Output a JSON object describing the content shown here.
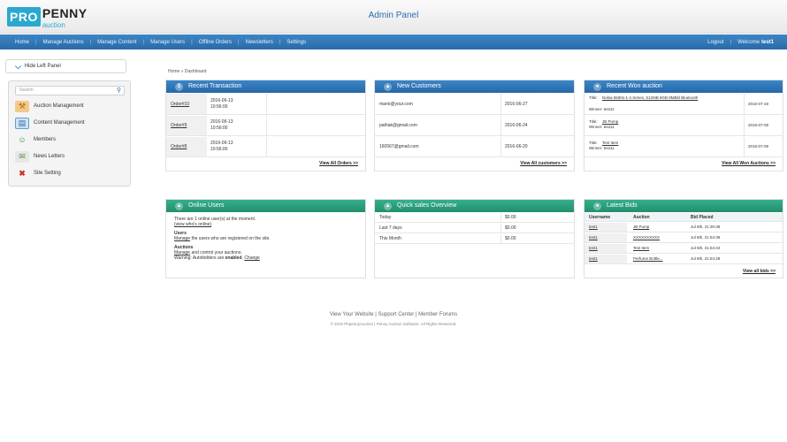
{
  "logo": {
    "pro": "PRO",
    "penny": "PENNY",
    "auction": "auction"
  },
  "header": {
    "title": "Admin Panel"
  },
  "nav": {
    "items": [
      "Home",
      "Manage Auctions",
      "Manage Content",
      "Manage Users",
      "Offline Orders",
      "Newsletters",
      "Settings"
    ],
    "logout": "Logout",
    "welcome": "Welcome",
    "username": "test1"
  },
  "sidebar": {
    "hide_label": "Hide Left Panel",
    "search_placeholder": "Search",
    "items": [
      "Auction Management",
      "Content Management",
      "Members",
      "News Letters",
      "Site Setting"
    ]
  },
  "breadcrumb": "Home » Dashboard",
  "recent_transaction": {
    "title": "Recent Transaction",
    "rows": [
      {
        "order": "Order#10",
        "date": "2016-06-13",
        "time": "10:56:00"
      },
      {
        "order": "Order#9",
        "date": "2016-06-13",
        "time": "10:56:00"
      },
      {
        "order": "Order#8",
        "date": "2016-06-13",
        "time": "10:56:00"
      }
    ],
    "view_all": "View All Orders >>"
  },
  "new_customers": {
    "title": "New Customers",
    "rows": [
      {
        "email": "mario@your.com",
        "date": "2016-06-27"
      },
      {
        "email": "pathak@gmail.com",
        "date": "2016-06-24"
      },
      {
        "email": "160567@gmail.com",
        "date": "2016-06-20"
      }
    ],
    "view_all": "View All customers >>"
  },
  "recent_won": {
    "title": "Recent Won auction",
    "rows": [
      {
        "title_label": "Title:",
        "title": "Nokia 6500s-1-4 Series, 512MB 8GB 8MBbl Bluetooth",
        "winner": "Winner: test11",
        "date": "2016-07-19"
      },
      {
        "title_label": "Title:",
        "title": "JB Pump",
        "winner": "Winner: test11",
        "date": "2016-07-09"
      },
      {
        "title_label": "Title:",
        "title": "Test Item",
        "winner": "Winner: test11",
        "date": "2016-07-09"
      }
    ],
    "view_all": "View All Won Auctions >>"
  },
  "online_users": {
    "title": "Online Users",
    "line1": "There are 1 online user(s) at the moment.",
    "line1_link": "(view who's online)",
    "users_heading": "Users",
    "users_link": "Manage",
    "users_text": " the users who are registered on the site.",
    "auctions_heading": "Auctions",
    "auctions_link": "Manage",
    "auctions_text": " and control your auctions.",
    "warning_prefix": "Warning: Autobidders are ",
    "warning_state": "enabled",
    "change_link": "Change"
  },
  "quick_sales": {
    "title": "Quick sales Overview",
    "rows": [
      {
        "label": "Today",
        "value": "$0.00"
      },
      {
        "label": "Last 7 days",
        "value": "$0.00"
      },
      {
        "label": "This Month",
        "value": "$0.00"
      }
    ]
  },
  "latest_bids": {
    "title": "Latest Bids",
    "headers": [
      "Username",
      "Auction",
      "Bid Placed"
    ],
    "rows": [
      {
        "user": "test1",
        "auction": "JB Pump",
        "placed": "Jul 6th, 21:30:38"
      },
      {
        "user": "test1",
        "auction": "XXXXXXXXXX",
        "placed": "Jul 6th, 21:54:38"
      },
      {
        "user": "test1",
        "auction": "Test Item",
        "placed": "Jul 6th, 21:54:34"
      },
      {
        "user": "test1",
        "auction": "Perfume Bottle...",
        "placed": "Jul 6th, 21:54:28"
      }
    ],
    "view_all": "View all bids >>"
  },
  "footer": {
    "links": [
      "View Your Website",
      "Support Center",
      "Member Forums"
    ],
    "copyright": "© 2016 PhpennyAuction | Penny Auction Software. All Rights Reserved."
  }
}
